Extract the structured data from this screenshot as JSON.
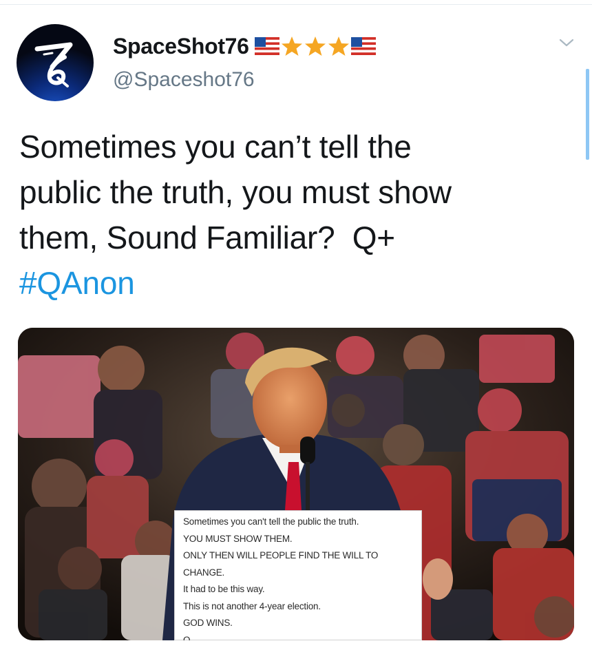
{
  "user": {
    "display_name": "SpaceShot76",
    "handle": "@Spaceshot76",
    "avatar_text": "76",
    "name_emojis": [
      "us-flag-icon",
      "star-icon",
      "star-icon",
      "star-icon",
      "us-flag-icon"
    ]
  },
  "tweet": {
    "text_lines": [
      "Sometimes you can’t tell the",
      "public the truth, you must show",
      "them, Sound Familiar?  Q+"
    ],
    "hashtag": "#QAnon"
  },
  "media": {
    "caption_lines": [
      "Sometimes you can't tell the public the truth.",
      "YOU MUST SHOW THEM.",
      "ONLY THEN WILL PEOPLE FIND THE WILL TO",
      "CHANGE.",
      "It had to be this way.",
      "This is not another 4-year election.",
      "GOD WINS.",
      "Q"
    ]
  },
  "colors": {
    "text": "#14171a",
    "secondary": "#657786",
    "link": "#1b95e0",
    "star": "#f5a623",
    "scrollbar": "#8ec7f4"
  },
  "icons": {
    "menu": "chevron-down-icon"
  }
}
